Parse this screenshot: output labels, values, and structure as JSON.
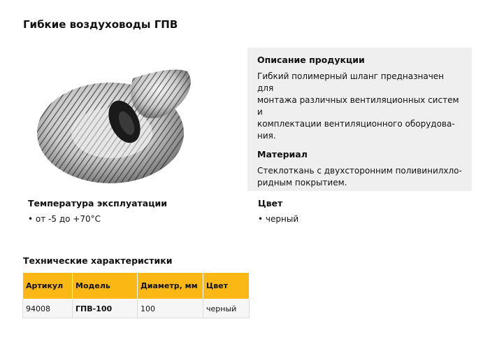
{
  "page": {
    "title": "Гибкие воздуховоды ГПВ"
  },
  "image": {
    "icon": "flexible-duct-hose-coil-image"
  },
  "description": {
    "heading": "Описание продукции",
    "lines": [
      "Гибкий полимерный шланг предназначен для",
      "монтажа различных вентиляционных систем и",
      "комплектации вентиляционного оборудова-",
      "ния."
    ],
    "material_heading": "Материал",
    "material_lines": [
      "Стеклоткань с двухсторонним поливинилхло-",
      "ридным покрытием."
    ]
  },
  "temperature": {
    "heading": "Температура эксплуатации",
    "value": "от -5 до +70°С"
  },
  "color": {
    "heading": "Цвет",
    "value": "черный"
  },
  "specs": {
    "heading": "Технические характеристики",
    "columns": [
      "Артикул",
      "Модель",
      "Диаметр, мм",
      "Цвет"
    ],
    "rows": [
      [
        "94008",
        "ГПВ-100",
        "100",
        "черный"
      ]
    ]
  },
  "colors": {
    "header_bg": "#fbb714",
    "panel_bg": "#efefef"
  }
}
